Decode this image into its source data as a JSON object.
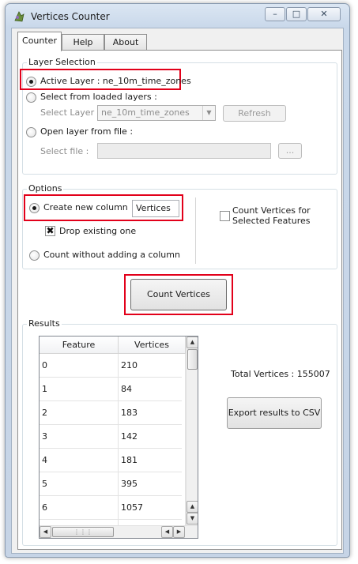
{
  "window": {
    "title": "Vertices Counter",
    "caption_buttons": {
      "minimize": "–",
      "maximize": "□",
      "close": "✕"
    }
  },
  "tabs": [
    {
      "label": "Counter",
      "active": true
    },
    {
      "label": "Help",
      "active": false
    },
    {
      "label": "About",
      "active": false
    }
  ],
  "layer_selection": {
    "title": "Layer Selection",
    "active_layer": {
      "label": "Active Layer : ne_10m_time_zones",
      "checked": true
    },
    "from_loaded": {
      "label": "Select from loaded layers :",
      "select_label": "Select Layer",
      "select_value": "ne_10m_time_zones",
      "refresh_label": "Refresh"
    },
    "from_file": {
      "label": "Open layer from file :",
      "file_label": "Select file :",
      "file_value": "",
      "browse_label": "..."
    }
  },
  "options": {
    "title": "Options",
    "create_column": {
      "label": "Create new column",
      "checked": true,
      "field_value": "Vertices"
    },
    "drop_existing": {
      "label": "Drop existing one",
      "checked": true,
      "mark": "✖"
    },
    "no_column": {
      "label": "Count without adding a column",
      "checked": false
    },
    "selected_features": {
      "label_line1": "Count Vertices for",
      "label_line2": "Selected Features",
      "checked": false
    }
  },
  "count_button": {
    "label": "Count Vertices"
  },
  "results": {
    "title": "Results",
    "columns": [
      "Feature",
      "Vertices"
    ],
    "rows": [
      [
        "0",
        "210"
      ],
      [
        "1",
        "84"
      ],
      [
        "2",
        "183"
      ],
      [
        "3",
        "142"
      ],
      [
        "4",
        "181"
      ],
      [
        "5",
        "395"
      ],
      [
        "6",
        "1057"
      ]
    ],
    "total_text": "Total Vertices : 155007",
    "export_label": "Export results to CSV"
  },
  "scroll_glyphs": {
    "up": "▲",
    "down": "▼",
    "left": "◀",
    "right": "▶",
    "grip": "⋮⋮⋮"
  },
  "colors": {
    "highlight": "#e2001a",
    "window_frame": "#c9d8ea",
    "panel": "#ffffff"
  }
}
